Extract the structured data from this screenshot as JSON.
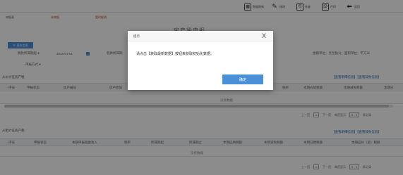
{
  "toolbar": {
    "buttons": [
      {
        "label": "数据刷新",
        "icon": "▦"
      },
      {
        "label": "修改",
        "icon": "✎"
      },
      {
        "label": "作废",
        "icon": "⎘"
      },
      {
        "label": "打印",
        "icon": "⎙"
      },
      {
        "label": "返回",
        "icon": "⬅"
      }
    ]
  },
  "infobar": {
    "status_label": "申报表",
    "status_value": "未申报",
    "check_value": "暂时检测"
  },
  "page_title": "房产税申报",
  "basic_info_label": "基本信息",
  "form": {
    "period_label": "税款所属期起",
    "period_start": "2018-01-01",
    "period_end_label": "税款所属期",
    "method_label": "申报方式",
    "unit_label": "金额单位：元至角分；面积单位：平方米"
  },
  "section1": {
    "title": "从价计征房产税",
    "links": "【查看明细信息】【查看减免信息】",
    "headers": [
      "序号",
      "申报状态",
      "房产编号",
      "房产原值",
      "税率",
      "本期应纳税额",
      "本期减免税额",
      "本期已"
    ],
    "empty": "没有数据",
    "pager": {
      "prev": "上一页",
      "page": "1",
      "next": "下一页",
      "per_page_label": "每页显示",
      "per_page": "5",
      "total": "条记录"
    }
  },
  "section2": {
    "title": "从租计征房产税",
    "links": "【查看明细信息】【查看减免信息】",
    "headers": [
      "序号",
      "申报状态",
      "本期申报租金收入",
      "税率",
      "所属期起",
      "所属期止",
      "本期应纳税额",
      "本期减免税额",
      "本期已缴税额",
      "本期应补（退）税额"
    ],
    "empty": "没有数据",
    "pager": {
      "prev": "上一页",
      "page": "1",
      "next": "下一页",
      "per_page_label": "每页显示",
      "per_page": "5",
      "total": "条记录"
    }
  },
  "modal": {
    "title": "提示",
    "close": "X",
    "message": "请点击【获取最新数据】按钮来获取初始化数据。",
    "ok_label": "确定"
  },
  "colors": {
    "accent": "#4a90d9",
    "danger": "#c0392b",
    "overlay": "rgba(0,0,0,0.45)"
  }
}
